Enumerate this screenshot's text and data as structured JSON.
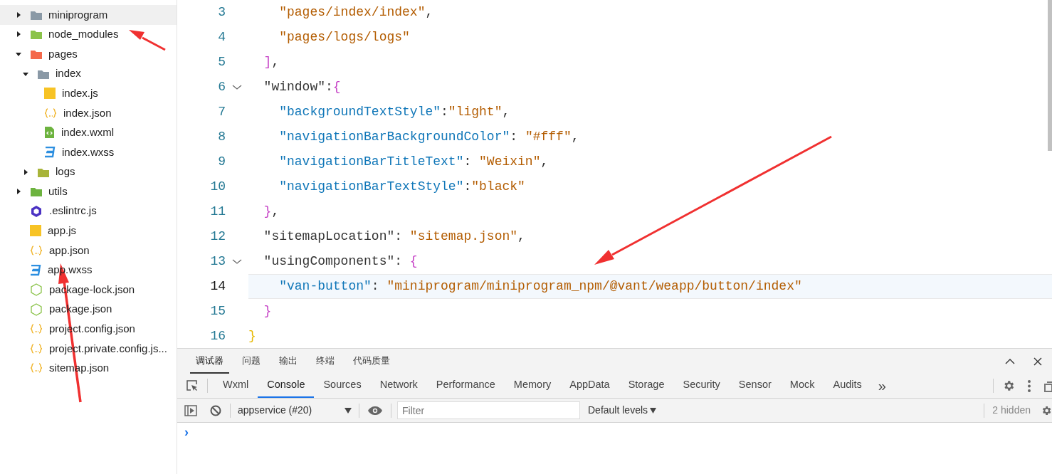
{
  "file_tree": [
    {
      "label": "miniprogram",
      "kind": "folder",
      "color": "#8a99a6",
      "expanded": false,
      "selected": true
    },
    {
      "label": "node_modules",
      "kind": "folder",
      "color": "#8bc34a",
      "expanded": false,
      "selected": false
    },
    {
      "label": "pages",
      "kind": "folder",
      "color": "#f4694b",
      "expanded": true,
      "selected": false,
      "children": [
        {
          "label": "index",
          "kind": "folder",
          "color": "#8a99a6",
          "expanded": true,
          "selected": false,
          "children": [
            {
              "label": "index.js",
              "kind": "js",
              "selected": false
            },
            {
              "label": "index.json",
              "kind": "json",
              "selected": false
            },
            {
              "label": "index.wxml",
              "kind": "wxml",
              "selected": false
            },
            {
              "label": "index.wxss",
              "kind": "wxss",
              "selected": false
            }
          ]
        },
        {
          "label": "logs",
          "kind": "folder",
          "color": "#a8b43a",
          "expanded": false,
          "selected": false
        }
      ]
    },
    {
      "label": "utils",
      "kind": "folder",
      "color": "#6db33f",
      "expanded": false,
      "selected": false
    },
    {
      "label": ".eslintrc.js",
      "kind": "eslint",
      "selected": false
    },
    {
      "label": "app.js",
      "kind": "js",
      "selected": false
    },
    {
      "label": "app.json",
      "kind": "json",
      "selected": false
    },
    {
      "label": "app.wxss",
      "kind": "wxss",
      "selected": false
    },
    {
      "label": "package-lock.json",
      "kind": "node",
      "selected": false
    },
    {
      "label": "package.json",
      "kind": "node",
      "selected": false
    },
    {
      "label": "project.config.json",
      "kind": "json",
      "selected": false
    },
    {
      "label": "project.private.config.js...",
      "kind": "json",
      "selected": false
    },
    {
      "label": "sitemap.json",
      "kind": "json",
      "selected": false
    }
  ],
  "editor": {
    "lines": [
      {
        "number": "3",
        "foldable": false,
        "current": false,
        "tokens": [
          {
            "kind": "string",
            "text": "    \"pages/index/index\""
          },
          {
            "kind": "punct",
            "text": ","
          }
        ]
      },
      {
        "number": "4",
        "foldable": false,
        "current": false,
        "tokens": [
          {
            "kind": "string",
            "text": "    \"pages/logs/logs\""
          }
        ]
      },
      {
        "number": "5",
        "foldable": false,
        "current": false,
        "tokens": [
          {
            "kind": "bracket",
            "text": "  ]"
          },
          {
            "kind": "punct",
            "text": ","
          }
        ]
      },
      {
        "number": "6",
        "foldable": true,
        "current": false,
        "tokens": [
          {
            "kind": "plain",
            "text": "  \"window\""
          },
          {
            "kind": "punct",
            "text": ":"
          },
          {
            "kind": "bracket",
            "text": "{"
          }
        ]
      },
      {
        "number": "7",
        "foldable": false,
        "current": false,
        "tokens": [
          {
            "kind": "key",
            "text": "    \"backgroundTextStyle\""
          },
          {
            "kind": "punct",
            "text": ":"
          },
          {
            "kind": "string",
            "text": "\"light\""
          },
          {
            "kind": "punct",
            "text": ","
          }
        ]
      },
      {
        "number": "8",
        "foldable": false,
        "current": false,
        "tokens": [
          {
            "kind": "key",
            "text": "    \"navigationBarBackgroundColor\""
          },
          {
            "kind": "punct",
            "text": ": "
          },
          {
            "kind": "string",
            "text": "\"#fff\""
          },
          {
            "kind": "punct",
            "text": ","
          }
        ]
      },
      {
        "number": "9",
        "foldable": false,
        "current": false,
        "tokens": [
          {
            "kind": "key",
            "text": "    \"navigationBarTitleText\""
          },
          {
            "kind": "punct",
            "text": ": "
          },
          {
            "kind": "string",
            "text": "\"Weixin\""
          },
          {
            "kind": "punct",
            "text": ","
          }
        ]
      },
      {
        "number": "10",
        "foldable": false,
        "current": false,
        "tokens": [
          {
            "kind": "key",
            "text": "    \"navigationBarTextStyle\""
          },
          {
            "kind": "punct",
            "text": ":"
          },
          {
            "kind": "string",
            "text": "\"black\""
          }
        ]
      },
      {
        "number": "11",
        "foldable": false,
        "current": false,
        "tokens": [
          {
            "kind": "bracket",
            "text": "  }"
          },
          {
            "kind": "punct",
            "text": ","
          }
        ]
      },
      {
        "number": "12",
        "foldable": false,
        "current": false,
        "tokens": [
          {
            "kind": "plain",
            "text": "  \"sitemapLocation\""
          },
          {
            "kind": "punct",
            "text": ": "
          },
          {
            "kind": "string",
            "text": "\"sitemap.json\""
          },
          {
            "kind": "punct",
            "text": ","
          }
        ]
      },
      {
        "number": "13",
        "foldable": true,
        "current": false,
        "tokens": [
          {
            "kind": "plain",
            "text": "  \"usingComponents\""
          },
          {
            "kind": "punct",
            "text": ": "
          },
          {
            "kind": "bracket",
            "text": "{"
          }
        ]
      },
      {
        "number": "14",
        "foldable": false,
        "current": true,
        "tokens": [
          {
            "kind": "key",
            "text": "    \"van-button\""
          },
          {
            "kind": "punct",
            "text": ": "
          },
          {
            "kind": "string",
            "text": "\"miniprogram/miniprogram_npm/@vant/weapp/button/index\""
          }
        ]
      },
      {
        "number": "15",
        "foldable": false,
        "current": false,
        "tokens": [
          {
            "kind": "bracket",
            "text": "  }"
          }
        ]
      },
      {
        "number": "16",
        "foldable": false,
        "current": false,
        "tokens": [
          {
            "kind": "brace",
            "text": "}"
          }
        ]
      }
    ]
  },
  "devtools": {
    "panel_tabs": [
      {
        "label": "调试器",
        "selected": true
      },
      {
        "label": "问题",
        "selected": false
      },
      {
        "label": "输出",
        "selected": false
      },
      {
        "label": "终端",
        "selected": false
      },
      {
        "label": "代码质量",
        "selected": false
      }
    ],
    "tool_tabs": [
      {
        "label": "Wxml",
        "selected": false
      },
      {
        "label": "Console",
        "selected": true
      },
      {
        "label": "Sources",
        "selected": false
      },
      {
        "label": "Network",
        "selected": false
      },
      {
        "label": "Performance",
        "selected": false
      },
      {
        "label": "Memory",
        "selected": false
      },
      {
        "label": "AppData",
        "selected": false
      },
      {
        "label": "Storage",
        "selected": false
      },
      {
        "label": "Security",
        "selected": false
      },
      {
        "label": "Sensor",
        "selected": false
      },
      {
        "label": "Mock",
        "selected": false
      },
      {
        "label": "Audits",
        "selected": false
      }
    ],
    "more_tabs": "»",
    "console": {
      "context": "appservice (#20)",
      "filter_placeholder": "Filter",
      "levels": "Default levels",
      "hidden": "2 hidden",
      "prompt": "›"
    }
  }
}
